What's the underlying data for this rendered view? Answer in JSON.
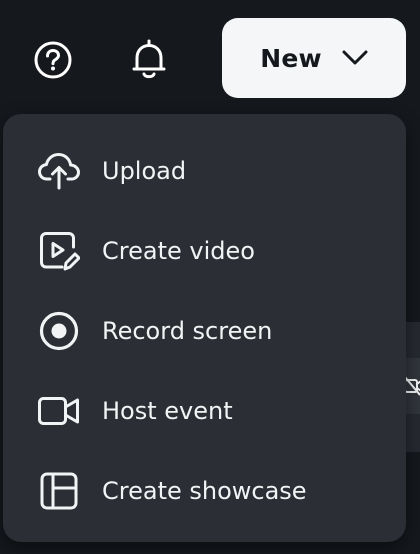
{
  "header": {
    "help_icon": "question-circle-icon",
    "notifications_icon": "bell-icon",
    "new_button": {
      "label": "New",
      "icon": "chevron-down-icon"
    }
  },
  "menu": {
    "items": [
      {
        "label": "Upload",
        "icon": "cloud-upload-icon"
      },
      {
        "label": "Create video",
        "icon": "video-edit-icon"
      },
      {
        "label": "Record screen",
        "icon": "record-icon"
      },
      {
        "label": "Host event",
        "icon": "video-camera-icon"
      },
      {
        "label": "Create showcase",
        "icon": "showcase-layout-icon"
      }
    ]
  },
  "colors": {
    "background": "#15181d",
    "menu_background": "#2b2f35",
    "text": "#f2f3f5",
    "button_background": "#f5f6f8",
    "button_text": "#15181d"
  }
}
